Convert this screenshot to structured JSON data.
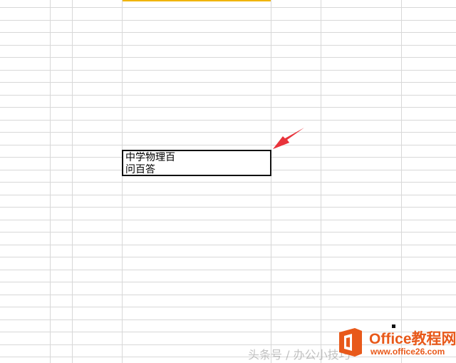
{
  "cell": {
    "text": "中学物理百\n问百答"
  },
  "colors": {
    "grid_line": "#d8d8d8",
    "column_highlight": "#f0b400",
    "selection_border": "#111111",
    "arrow": "#e8333b",
    "watermark": "#e8591a"
  },
  "icons": {
    "arrow": "red-arrow-icon",
    "logo": "office-logo-icon"
  },
  "watermark": {
    "faint_text": "头条号 / 办公小技巧",
    "title": "Office教程网",
    "url": "www.office26.com"
  }
}
